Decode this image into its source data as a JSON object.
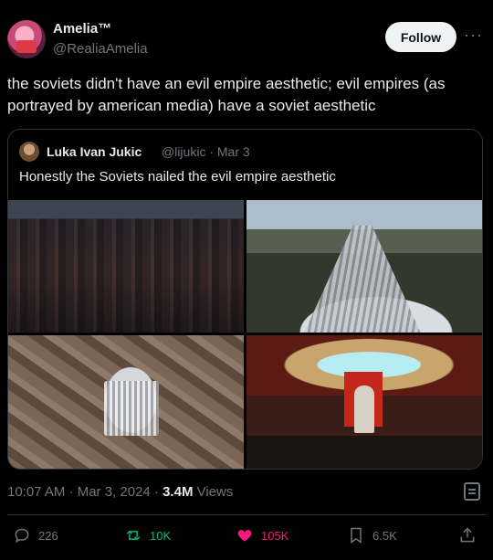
{
  "author": {
    "name": "Amelia™",
    "handle": "@RealiaAmelia",
    "follow_label": "Follow",
    "more_label": "···"
  },
  "tweet": {
    "text": "the soviets didn't have an evil empire aesthetic; evil empires (as portrayed by american media) have a soviet aesthetic"
  },
  "quote": {
    "name": "Luka Ivan Jukic",
    "handle_date": "@lijukic · Mar 3",
    "text": "Honestly the Soviets nailed the evil empire aesthetic"
  },
  "meta": {
    "timestamp": "10:07 AM · Mar 3, 2024 · ",
    "views_count": "3.4M",
    "views_label": " Views"
  },
  "actions": {
    "replies": "226",
    "reposts": "10K",
    "likes": "105K",
    "bookmarks": "6.5K"
  },
  "colors": {
    "background": "#000000",
    "text": "#e7e9ea",
    "muted": "#71767b",
    "repost": "#00ba7c",
    "like": "#f91880"
  }
}
